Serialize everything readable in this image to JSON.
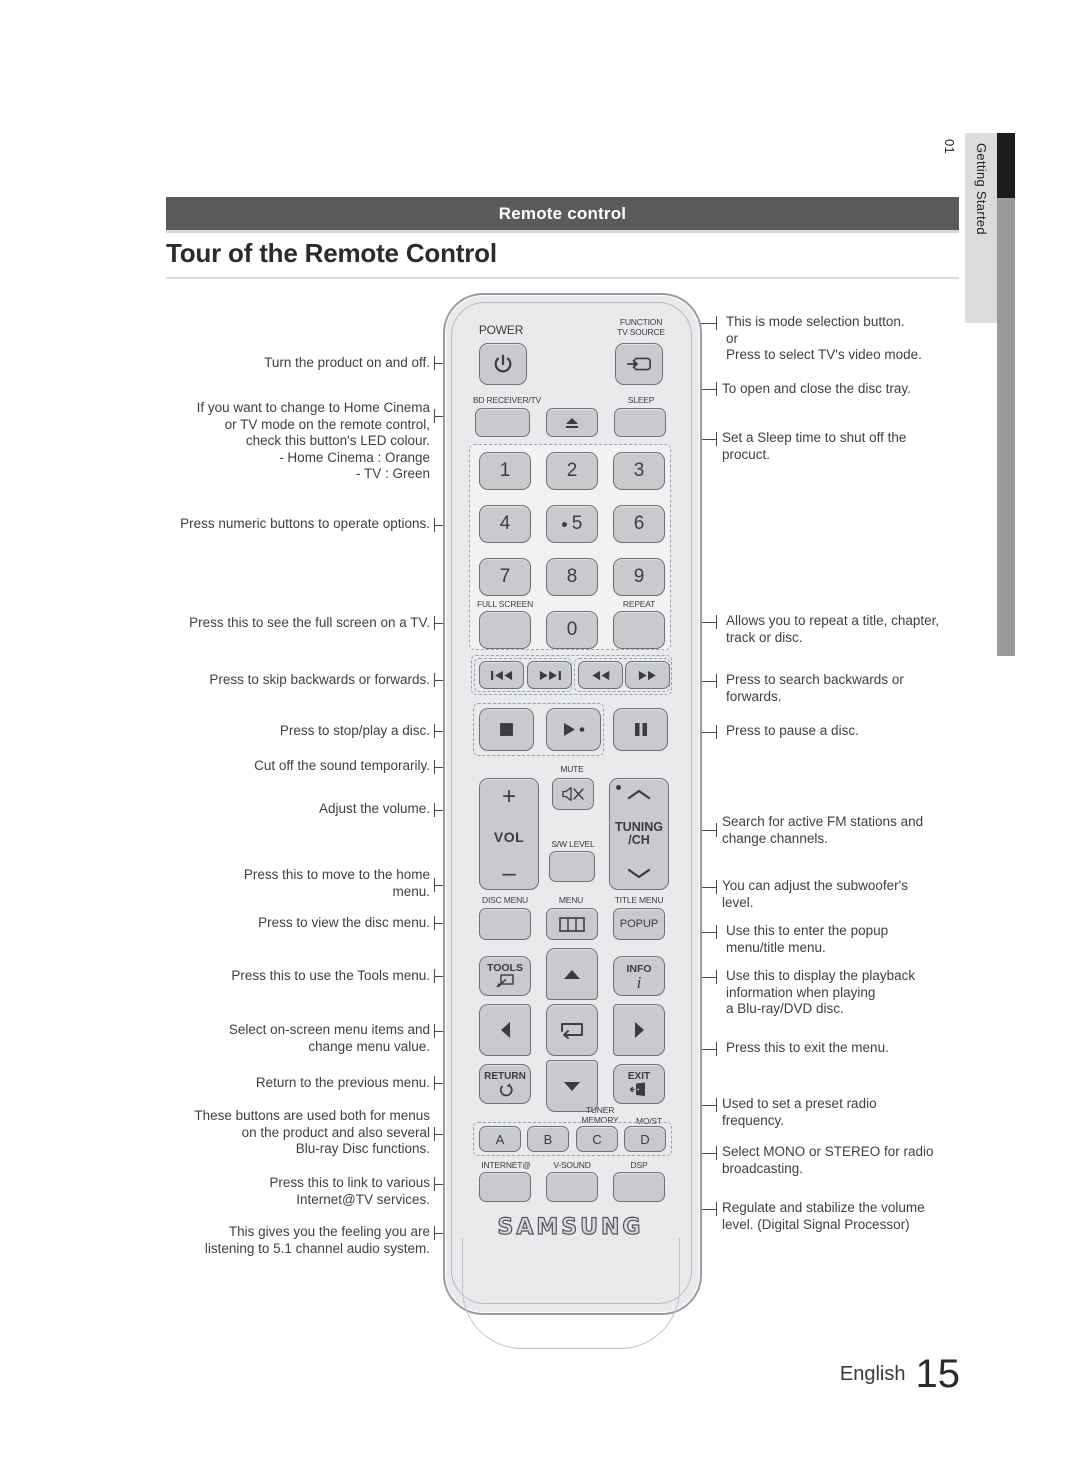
{
  "sidebar": {
    "number": "01",
    "label": "Getting Started"
  },
  "header": {
    "section_title": "Remote control",
    "page_title": "Tour of the Remote Control"
  },
  "footer": {
    "language": "English",
    "page_number": "15"
  },
  "brand": "SAMSUNG",
  "colors": {
    "header_bar": "#5a5a5c",
    "sidebar_tab": "#dcdcdc",
    "sidebar_black": "#1c1c1c",
    "sidebar_gray": "#9a9a9a",
    "button_face": "#c9cacd",
    "button_border": "#6e6f77",
    "remote_body": "#e9eaec"
  },
  "left_callouts": [
    {
      "id": "power",
      "text": "Turn the product on and off."
    },
    {
      "id": "bd-receiver-tv",
      "text": "If you want to change to Home Cinema\nor TV mode on the remote control,\ncheck this button's LED colour.\n- Home Cinema : Orange\n- TV : Green"
    },
    {
      "id": "numeric",
      "text": "Press numeric buttons to operate options."
    },
    {
      "id": "full-screen",
      "text": "Press this to see the full screen on a TV."
    },
    {
      "id": "skip",
      "text": "Press to skip backwards or forwards."
    },
    {
      "id": "stop-play",
      "text": "Press to stop/play a disc."
    },
    {
      "id": "mute",
      "text": "Cut off the sound temporarily."
    },
    {
      "id": "volume",
      "text": "Adjust the volume."
    },
    {
      "id": "home-menu",
      "text": "Press this to move to the home\nmenu."
    },
    {
      "id": "disc-menu",
      "text": "Press to view the disc menu."
    },
    {
      "id": "tools",
      "text": "Press this to use the Tools menu."
    },
    {
      "id": "navigation",
      "text": "Select on-screen menu items and\nchange menu value."
    },
    {
      "id": "return",
      "text": "Return to the previous menu."
    },
    {
      "id": "colour-buttons",
      "text": "These buttons are used both for menus\non the product and also several\nBlu-ray Disc functions."
    },
    {
      "id": "internet-tv",
      "text": "Press this to link to various\nInternet@TV services."
    },
    {
      "id": "v-sound",
      "text": "This gives you the feeling you are\nlistening to 5.1 channel audio system."
    }
  ],
  "right_callouts": [
    {
      "id": "function-tv-source",
      "text": "This is mode selection button.\nor\nPress to select TV's video mode."
    },
    {
      "id": "eject",
      "text": "To open and close the disc tray."
    },
    {
      "id": "sleep",
      "text": "Set a Sleep time to shut off the\nprocuct."
    },
    {
      "id": "repeat",
      "text": "Allows you to repeat a title, chapter,\ntrack or disc."
    },
    {
      "id": "search",
      "text": "Press to search backwards or\nforwards."
    },
    {
      "id": "pause",
      "text": "Press to pause a disc."
    },
    {
      "id": "tuning-ch",
      "text": "Search for active FM stations and\nchange channels."
    },
    {
      "id": "sw-level",
      "text": "You can adjust the subwoofer's\nlevel."
    },
    {
      "id": "title-menu-popup",
      "text": "Use this to enter the popup\nmenu/title menu."
    },
    {
      "id": "info",
      "text": "Use this to display the playback\ninformation when playing\na Blu-ray/DVD disc."
    },
    {
      "id": "exit",
      "text": "Press this to exit the menu."
    },
    {
      "id": "tuner-memory",
      "text": "Used to set a preset radio\nfrequency."
    },
    {
      "id": "mo-st",
      "text": "Select MONO or STEREO for radio\nbroadcasting."
    },
    {
      "id": "dsp",
      "text": "Regulate and stabilize the volume\nlevel. (Digital Signal Processor)"
    }
  ],
  "remote": {
    "captions": {
      "power": "POWER",
      "function_tv_source": "FUNCTION\nTV SOURCE",
      "bd_receiver_tv": "BD RECEIVER/TV",
      "sleep": "SLEEP",
      "full_screen": "FULL SCREEN",
      "repeat": "REPEAT",
      "mute": "MUTE",
      "sw_level": "S/W LEVEL",
      "disc_menu": "DISC MENU",
      "menu": "MENU",
      "title_menu": "TITLE MENU",
      "tuner_memory": "TUNER\nMEMORY",
      "mo_st": "MO/ST",
      "internet_tv": "INTERNET@",
      "v_sound": "V-SOUND",
      "dsp": "DSP"
    },
    "keys": {
      "n1": "1",
      "n2": "2",
      "n3": "3",
      "n4": "4",
      "n5": "5",
      "n6": "6",
      "n7": "7",
      "n8": "8",
      "n9": "9",
      "n0": "0",
      "vol": "VOL",
      "vol_plus": "+",
      "vol_minus": "–",
      "tuning": "TUNING",
      "ch": "/CH",
      "popup": "POPUP",
      "tools": "TOOLS",
      "info": "INFO",
      "info_glyph": "i",
      "return": "RETURN",
      "exit": "EXIT",
      "a": "A",
      "b": "B",
      "c": "C",
      "d": "D"
    }
  }
}
